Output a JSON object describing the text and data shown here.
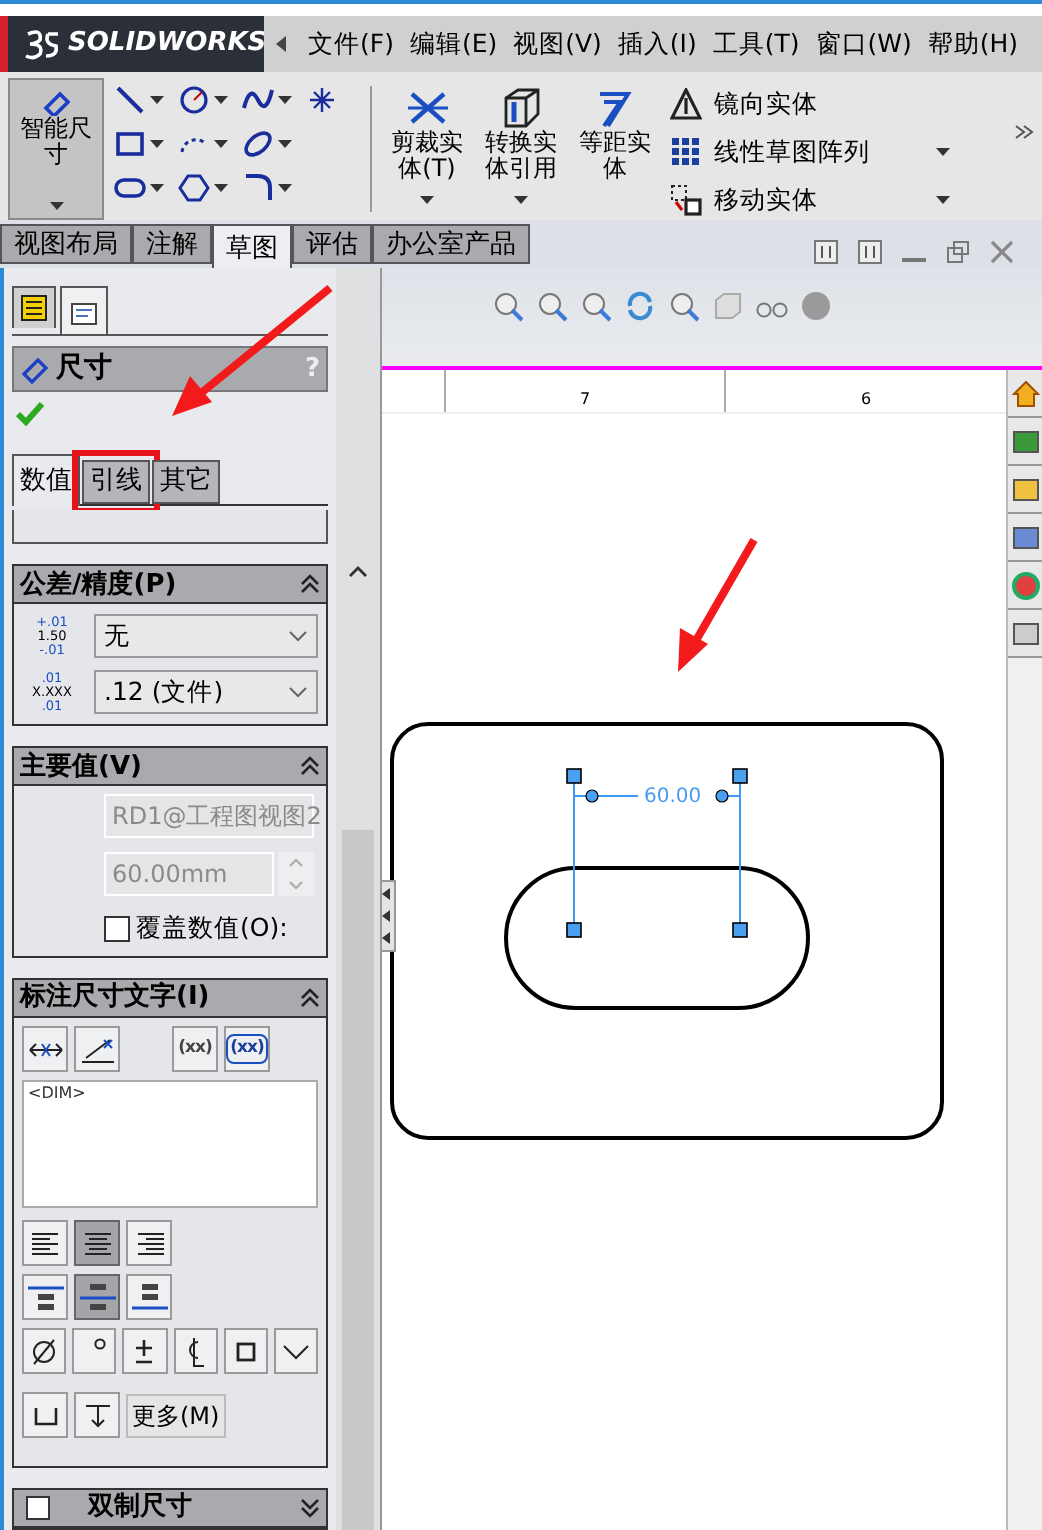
{
  "title_bar": {
    "logo": "SOLIDWORKS",
    "menus": [
      "文件(F)",
      "编辑(E)",
      "视图(V)",
      "插入(I)",
      "工具(T)",
      "窗口(W)",
      "帮助(H)"
    ]
  },
  "toolbar": {
    "smart_dimension": "智能尺寸",
    "big_commands": [
      {
        "kind": "trim",
        "label": "剪裁实体(T)",
        "dropdown": true
      },
      {
        "kind": "convert",
        "label": "转换实体引用",
        "dropdown": true
      },
      {
        "kind": "offset",
        "label": "等距实体",
        "dropdown": false
      }
    ],
    "list_commands": [
      {
        "kind": "mirror",
        "label": "镜向实体",
        "dropdown": false
      },
      {
        "kind": "pattern",
        "label": "线性草图阵列",
        "dropdown": true
      },
      {
        "kind": "move",
        "label": "移动实体",
        "dropdown": true
      }
    ]
  },
  "command_tabs": [
    {
      "label": "视图布局",
      "selected": false
    },
    {
      "label": "注解",
      "selected": false
    },
    {
      "label": "草图",
      "selected": true
    },
    {
      "label": "评估",
      "selected": false
    },
    {
      "label": "办公室产品",
      "selected": false
    }
  ],
  "property_manager": {
    "title": "尺寸",
    "help": "?",
    "tabs": [
      {
        "label": "数值",
        "selected": true,
        "highlighted": false
      },
      {
        "label": "引线",
        "selected": false,
        "highlighted": true
      },
      {
        "label": "其它",
        "selected": false,
        "highlighted": false
      }
    ],
    "sections": [
      {
        "kind": "tolerance",
        "title": "公差/精度(P)",
        "expanded": true,
        "tolerance_icon": [
          "+.01",
          "1.50",
          "-.01"
        ],
        "tolerance_type": "无",
        "precision_icon": [
          ".01",
          "X.XXX",
          ".01"
        ],
        "precision": ".12 (文件)"
      },
      {
        "kind": "primary_value",
        "title": "主要值(V)",
        "expanded": true,
        "reference": "RD1@工程图视图2",
        "value": "60.00mm",
        "override": {
          "label": "覆盖数值(O):",
          "checked": false
        }
      },
      {
        "kind": "dimension_text",
        "title": "标注尺寸文字(I)",
        "expanded": true,
        "paren_buttons": [
          "(xx)",
          "(xx)"
        ],
        "text": "<DIM>",
        "alignments": [
          {
            "selected": false
          },
          {
            "selected": true
          },
          {
            "selected": false
          }
        ],
        "layouts": [
          {
            "selected": false
          },
          {
            "selected": true
          },
          {
            "selected": false
          }
        ],
        "more": "更多(M)"
      },
      {
        "kind": "dual",
        "title": "双制尺寸",
        "expanded": false,
        "checked": false
      }
    ]
  },
  "canvas": {
    "ruler_labels": [
      "7",
      "6"
    ],
    "dimension": "60.00"
  }
}
